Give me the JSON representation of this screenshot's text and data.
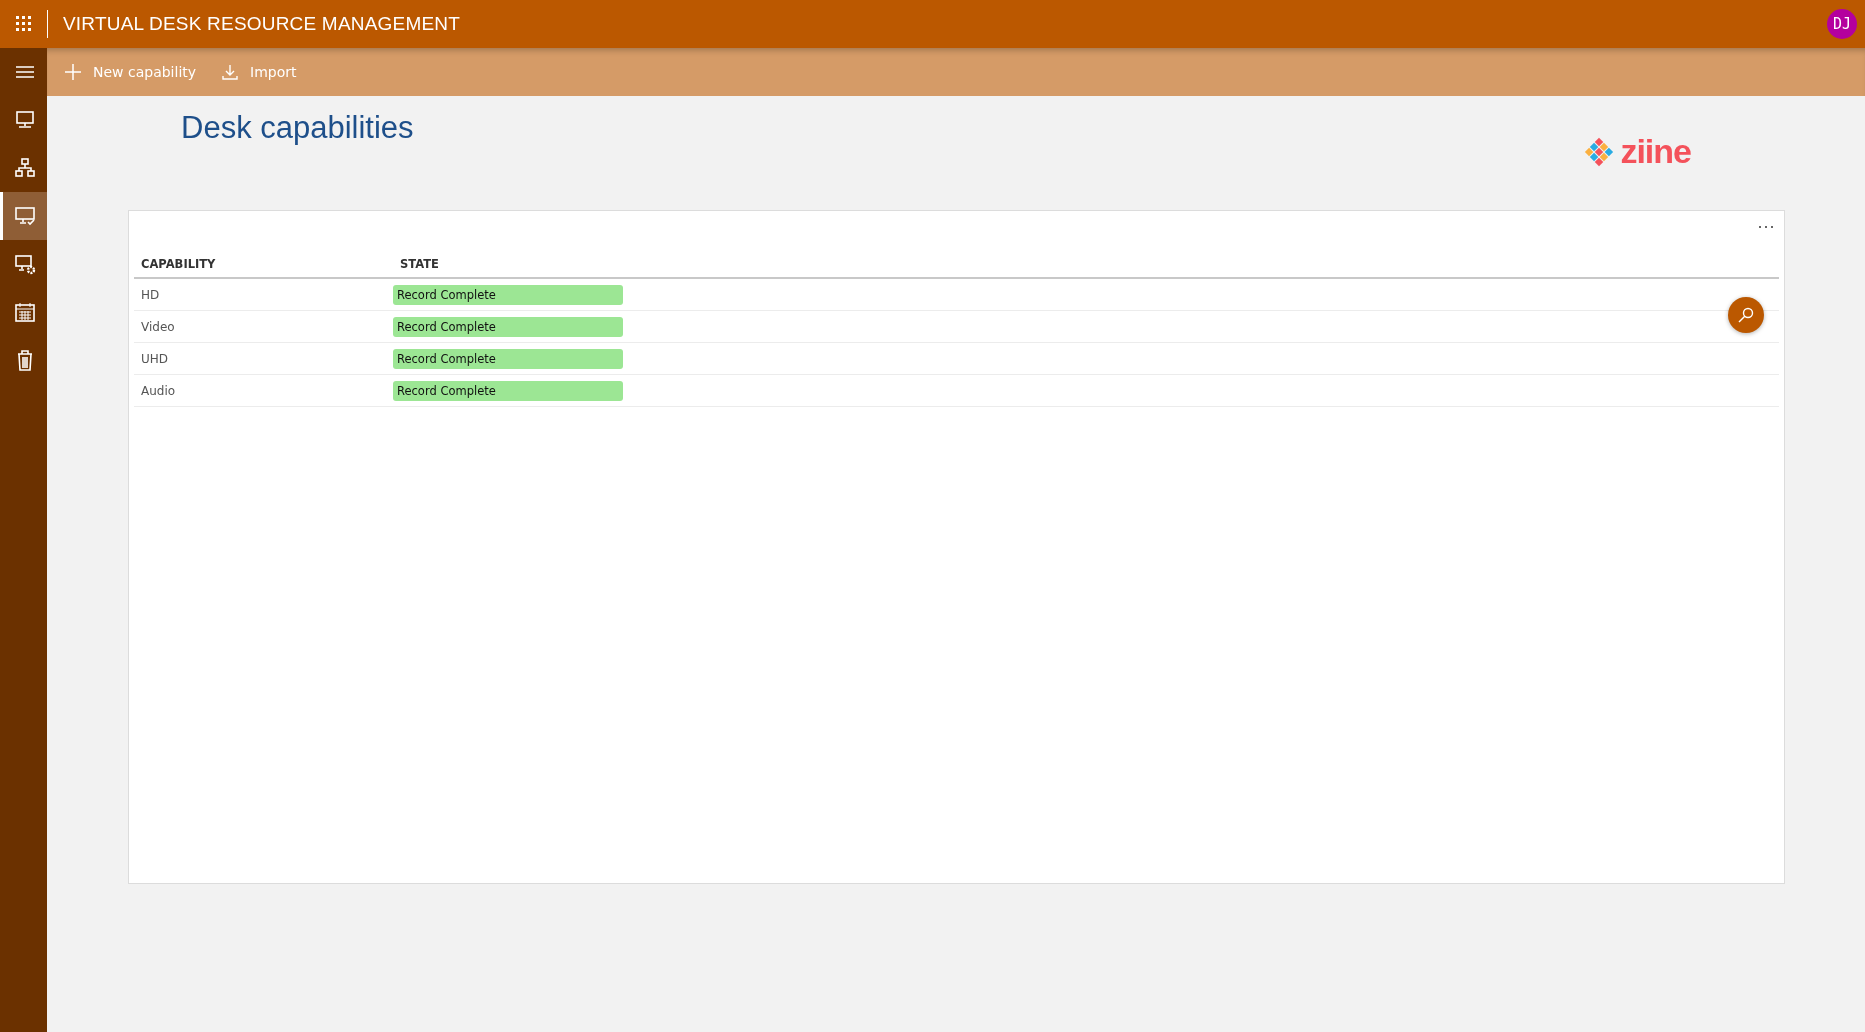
{
  "app_bar": {
    "title": "VIRTUAL DESK RESOURCE MANAGEMENT",
    "avatar": "DJ"
  },
  "nav": {
    "items": [
      {
        "kind": "monitor",
        "selected": false
      },
      {
        "kind": "hierarchy",
        "selected": false
      },
      {
        "kind": "monitor-check",
        "selected": true
      },
      {
        "kind": "monitor-gear",
        "selected": false
      },
      {
        "kind": "calendar",
        "selected": false
      },
      {
        "kind": "trash",
        "selected": false
      }
    ]
  },
  "toolbar": {
    "buttons": [
      {
        "kind": "add",
        "label": "New capability"
      },
      {
        "kind": "import",
        "label": "Import"
      }
    ]
  },
  "page": {
    "title": "Desk capabilities",
    "logo": "ziine"
  },
  "table": {
    "columns": [
      "CAPABILITY",
      "STATE"
    ],
    "rows": [
      {
        "capability": "HD",
        "state": "Record Complete"
      },
      {
        "capability": "Video",
        "state": "Record Complete"
      },
      {
        "capability": "UHD",
        "state": "Record Complete"
      },
      {
        "capability": "Audio",
        "state": "Record Complete"
      }
    ]
  }
}
